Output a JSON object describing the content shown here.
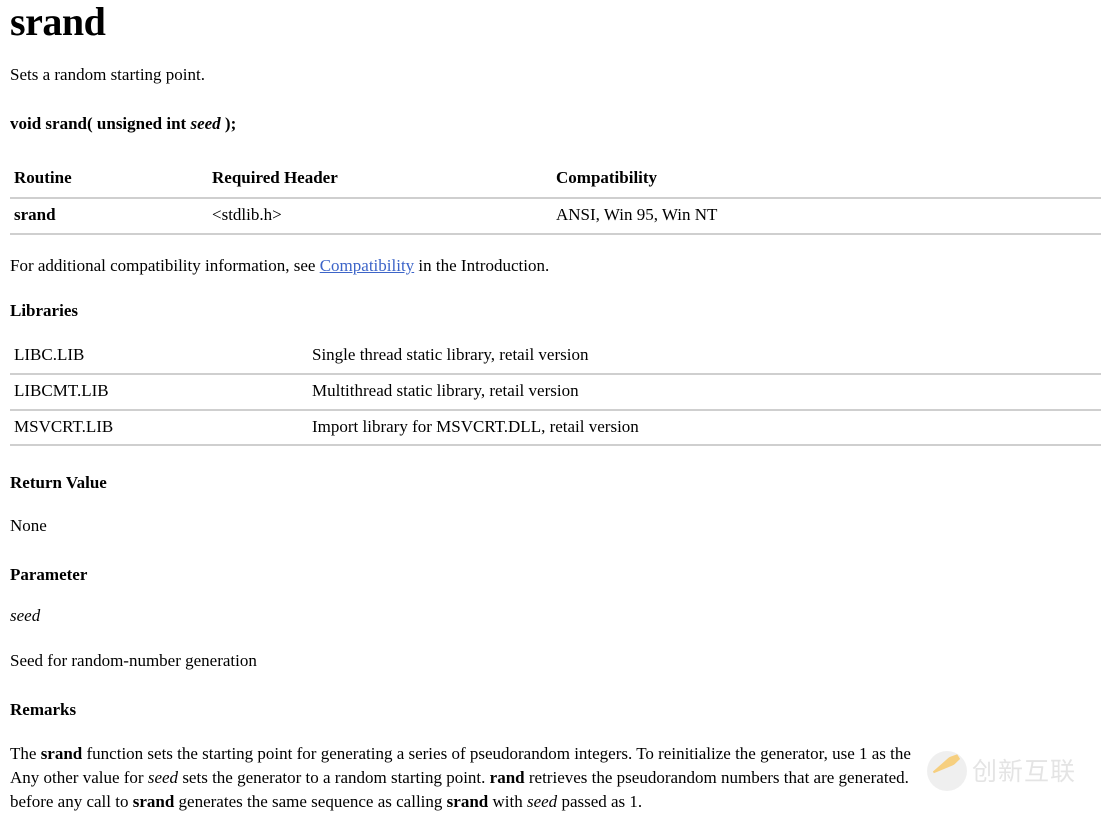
{
  "page": {
    "title": "srand",
    "summary": "Sets a random starting point.",
    "signature": {
      "prefix": "void srand( unsigned int ",
      "param": "seed",
      "suffix": " );"
    }
  },
  "routine_table": {
    "headers": [
      "Routine",
      "Required Header",
      "Compatibility"
    ],
    "rows": [
      {
        "routine": "srand",
        "header": "<stdlib.h>",
        "compatibility": "ANSI, Win 95, Win NT"
      }
    ]
  },
  "compat_note": {
    "before": "For additional compatibility information, see ",
    "link": "Compatibility",
    "after": " in the Introduction."
  },
  "libraries": {
    "heading": "Libraries",
    "rows": [
      {
        "name": "LIBC.LIB",
        "description": "Single thread static library, retail version"
      },
      {
        "name": "LIBCMT.LIB",
        "description": "Multithread static library, retail version"
      },
      {
        "name": "MSVCRT.LIB",
        "description": "Import library for MSVCRT.DLL, retail version"
      }
    ]
  },
  "return_value": {
    "heading": "Return Value",
    "text": "None"
  },
  "parameter": {
    "heading": "Parameter",
    "name": "seed",
    "description": "Seed for random-number generation"
  },
  "remarks": {
    "heading": "Remarks",
    "line1": {
      "t1": "The ",
      "b1": "srand",
      "t2": " function sets the starting point for generating a series of pseudorandom integers. To reinitialize the generator, use 1 as the"
    },
    "line2": {
      "t1": "Any other value for ",
      "i1": "seed",
      "t2": " sets the generator to a random starting point. ",
      "b1": "rand",
      "t3": " retrieves the pseudorandom numbers that are generated."
    },
    "line3": {
      "t1": "before any call to ",
      "b1": "srand",
      "t2": " generates the same sequence as calling ",
      "b2": "srand",
      "t3": " with ",
      "i1": "seed",
      "t4": " passed as 1."
    }
  },
  "watermark": {
    "text": "创新互联",
    "icon": "pencil-icon",
    "color": "#f0a818"
  },
  "colors": {
    "link": "#3c64c8",
    "rule": "#cfcfcf",
    "text": "#000000",
    "background": "#ffffff"
  }
}
